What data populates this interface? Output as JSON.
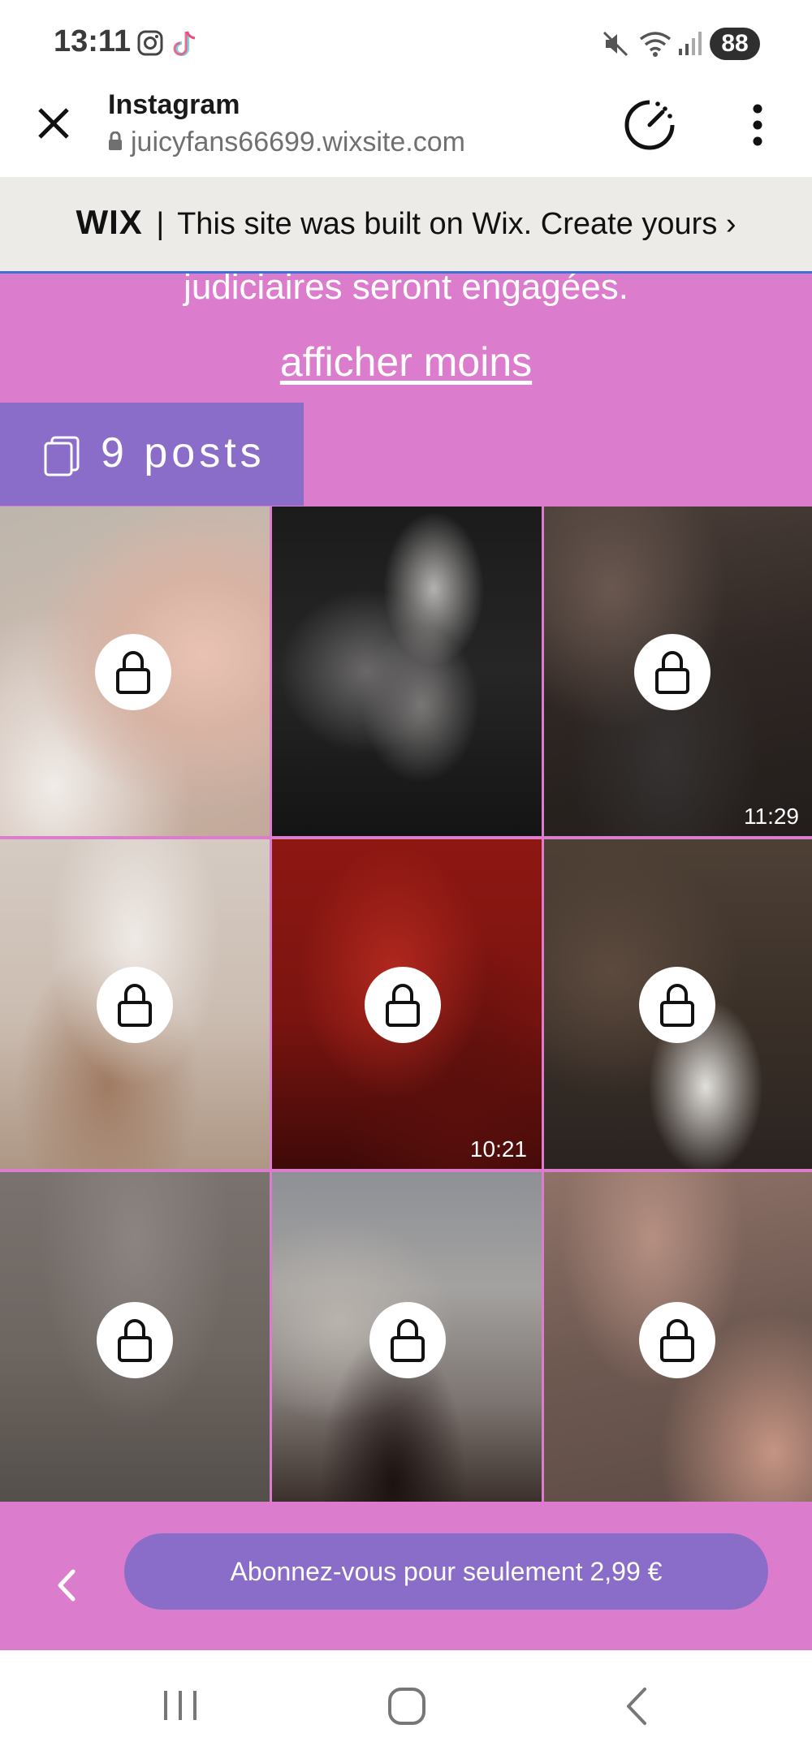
{
  "status_bar": {
    "time": "13:11",
    "battery": "88",
    "icons": [
      "instagram-icon",
      "tiktok-icon",
      "mute-icon",
      "wifi-icon",
      "signal-icon",
      "battery-icon"
    ]
  },
  "browser": {
    "title": "Instagram",
    "url": "juicyfans66699.wixsite.com",
    "icons": [
      "close-icon",
      "lock-icon",
      "speedometer-icon",
      "more-vertical-icon"
    ]
  },
  "wix_banner": {
    "logo": "WIX",
    "separator": "|",
    "text": "This site was built on Wix. Create yours",
    "chevron": "›"
  },
  "profile": {
    "description_tail": "judiciaires seront engagées.",
    "show_less": "afficher moins",
    "posts_count_label": "9 posts"
  },
  "grid": {
    "posts": [
      {
        "locked": true,
        "duration": ""
      },
      {
        "locked": false,
        "duration": ""
      },
      {
        "locked": true,
        "duration": "11:29"
      },
      {
        "locked": true,
        "duration": ""
      },
      {
        "locked": true,
        "duration": "10:21"
      },
      {
        "locked": true,
        "duration": ""
      },
      {
        "locked": true,
        "duration": ""
      },
      {
        "locked": true,
        "duration": ""
      },
      {
        "locked": true,
        "duration": ""
      }
    ]
  },
  "subscribe": {
    "label": "Abonnez-vous pour seulement 2,99 €"
  },
  "colors": {
    "page_background": "#dc7ccd",
    "accent_purple": "#8a6cc9",
    "wix_banner_bg": "#edebe7"
  }
}
